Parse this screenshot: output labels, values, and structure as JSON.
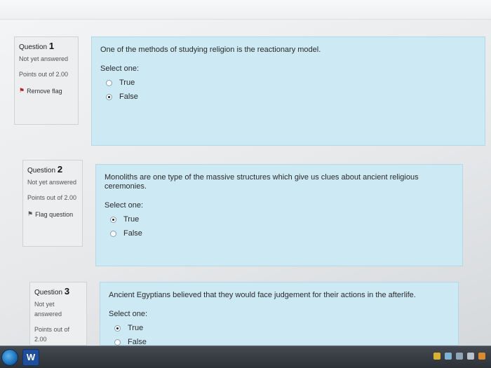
{
  "questions": [
    {
      "label": "Question",
      "number": "1",
      "state": "Not yet answered",
      "points": "Points out of 2.00",
      "flag_label": "Remove flag",
      "text": "One of the methods of studying religion is the reactionary model.",
      "select_label": "Select one:",
      "options": [
        {
          "label": "True",
          "selected": false
        },
        {
          "label": "False",
          "selected": true
        }
      ]
    },
    {
      "label": "Question",
      "number": "2",
      "state": "Not yet answered",
      "points": "Points out of 2.00",
      "flag_label": "Flag question",
      "text": "Monoliths are one type of the massive structures which give us clues about ancient religious ceremonies.",
      "select_label": "Select one:",
      "options": [
        {
          "label": "True",
          "selected": true
        },
        {
          "label": "False",
          "selected": false
        }
      ]
    },
    {
      "label": "Question",
      "number": "3",
      "state": "Not yet answered",
      "points": "Points out of 2.00",
      "flag_label": "",
      "text": "Ancient Egyptians believed that they would face judgement for their actions in the afterlife.",
      "select_label": "Select one:",
      "options": [
        {
          "label": "True",
          "selected": true
        },
        {
          "label": "False",
          "selected": false
        }
      ]
    }
  ],
  "taskbar": {
    "word_icon_label": "W"
  },
  "colors": {
    "content_bg": "#cde9f4",
    "info_bg": "#eceeef",
    "flag_red": "#b41d1d"
  }
}
